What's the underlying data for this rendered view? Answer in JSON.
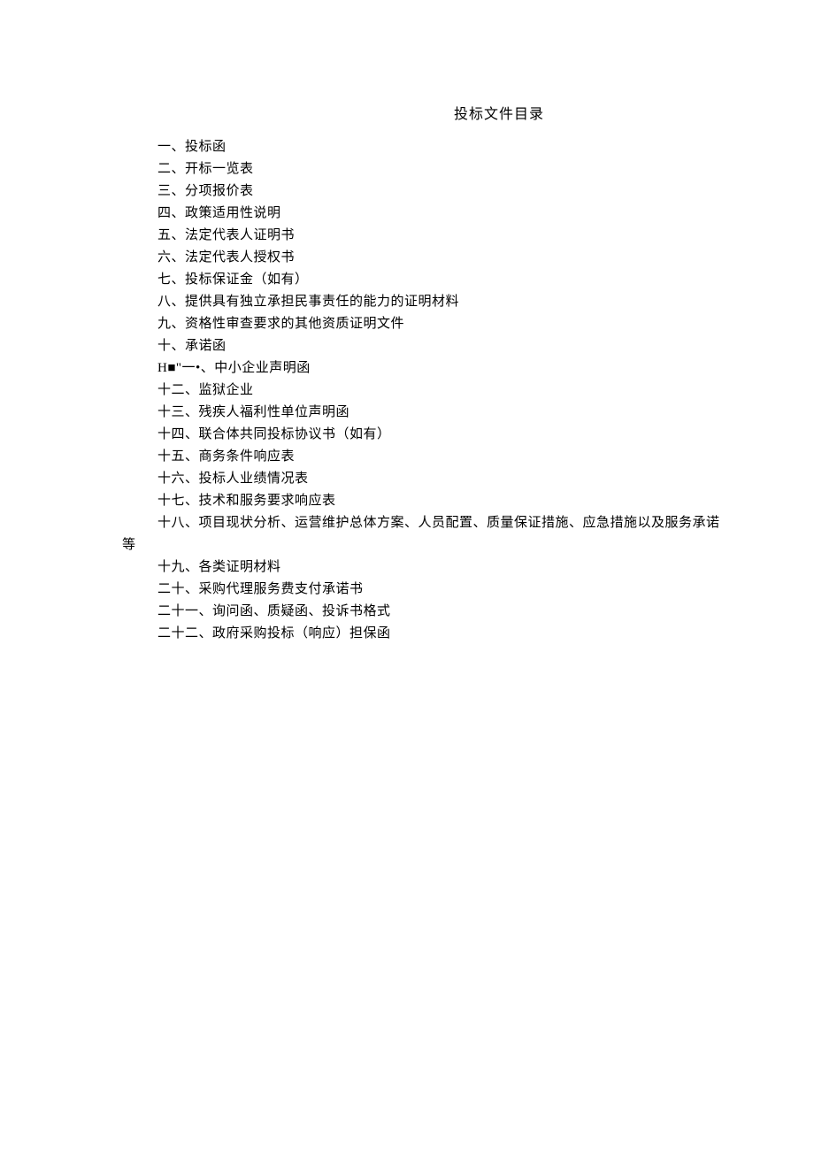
{
  "title": "投标文件目录",
  "items": [
    "一、投标函",
    "二、开标一览表",
    "三、分项报价表",
    "四、政策适用性说明",
    "五、法定代表人证明书",
    "六、法定代表人授权书",
    "七、投标保证金（如有）",
    "八、提供具有独立承担民事责任的能力的证明材料",
    "九、资格性审查要求的其他资质证明文件",
    "十、承诺函",
    "H■\"一•、中小企业声明函",
    "十二、监狱企业",
    "十三、残疾人福利性单位声明函",
    "十四、联合体共同投标协议书（如有）",
    "十五、商务条件响应表",
    "十六、投标人业绩情况表",
    "十七、技术和服务要求响应表",
    "十八、项目现状分析、运营维护总体方案、人员配置、质量保证措施、应急措施以及服务承诺"
  ],
  "hanging": "等",
  "items2": [
    "十九、各类证明材料",
    "二十、采购代理服务费支付承诺书",
    "二十一、询问函、质疑函、投诉书格式",
    "二十二、政府采购投标（响应）担保函"
  ]
}
